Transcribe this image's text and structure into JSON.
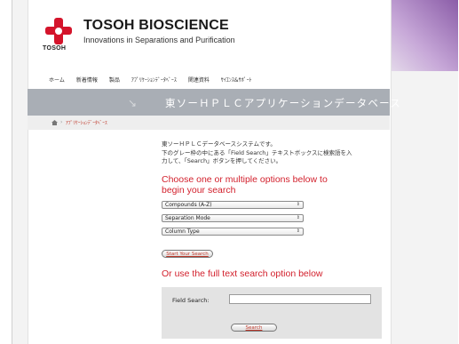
{
  "brand": {
    "logo_word": "TOSOH",
    "title": "TOSOH BIOSCIENCE",
    "tagline": "Innovations in Separations and Purification",
    "accent": "#d4142b"
  },
  "nav": {
    "items": [
      "ホーム",
      "新着情報",
      "製品",
      "ｱﾌﾟﾘｹｰｼｮﾝﾃﾞｰﾀﾍﾞｰｽ",
      "関連資料",
      "ｻｲｴﾝｽ&ｻﾎﾟｰﾄ"
    ]
  },
  "banner": {
    "arrow": "↘",
    "title": "東ソーＨＰＬＣアプリケーションデータベース"
  },
  "breadcrumb": {
    "separator": "›",
    "current": "ｱﾌﾟﾘｹｰｼｮﾝﾃﾞｰﾀﾍﾞｰｽ"
  },
  "content": {
    "intro_lines": [
      "東ソーＨＰＬＣデータベースシステムです。",
      "下のグレー枠の中にある「Field Search」テキストボックスに検索語を入",
      "力して、「Search」ボタンを押してください。"
    ],
    "heading_options": "Choose one or multiple options below to begin your search",
    "selects": [
      {
        "value": "Compounds (A-Z)"
      },
      {
        "value": "Separation Mode"
      },
      {
        "value": "Column Type"
      }
    ],
    "start_button": "Start Your Search",
    "heading_fulltext": "Or use the full text search option below",
    "field_search_label": "Field Search:",
    "field_search_value": "",
    "search_button": "Search"
  }
}
